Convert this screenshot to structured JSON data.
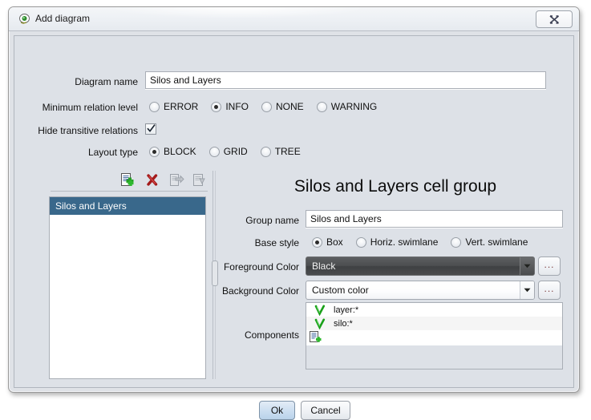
{
  "window": {
    "title": "Add diagram",
    "app_icon": "app-icon",
    "close_label": "x"
  },
  "form": {
    "diagram_name": {
      "label": "Diagram name",
      "value": "Silos and Layers",
      "placeholder": ""
    },
    "minimum_relation_level": {
      "label": "Minimum relation level",
      "options": [
        "ERROR",
        "INFO",
        "NONE",
        "WARNING"
      ],
      "selected": "INFO"
    },
    "hide_transitive_relations": {
      "label": "Hide transitive relations",
      "checked": true
    },
    "layout_type": {
      "label": "Layout type",
      "options": [
        "BLOCK",
        "GRID",
        "TREE"
      ],
      "selected": "BLOCK"
    }
  },
  "toolbar": {
    "add": "add-document-icon",
    "delete": "delete-icon",
    "move_right": "move-right-icon",
    "edit": "edit-document-icon"
  },
  "group_list": {
    "items": [
      {
        "label": "Silos and Layers",
        "selected": true
      }
    ]
  },
  "panel": {
    "title": "Silos and Layers cell group",
    "group_name": {
      "label": "Group name",
      "value": "Silos and Layers",
      "placeholder": ""
    },
    "base_style": {
      "label": "Base style",
      "options": [
        "Box",
        "Horiz. swimlane",
        "Vert. swimlane"
      ],
      "selected": "Box"
    },
    "foreground_color": {
      "label": "Foreground Color",
      "value": "Black",
      "browse_label": "..."
    },
    "background_color": {
      "label": "Background Color",
      "value": "Custom color",
      "browse_label": "..."
    },
    "components": {
      "label": "Components",
      "items": [
        {
          "icon": "green-check-icon",
          "text": "layer:*"
        },
        {
          "icon": "green-check-icon",
          "text": "silo:*"
        }
      ],
      "add_icon": "add-document-icon"
    }
  },
  "buttons": {
    "ok": "Ok",
    "cancel": "Cancel"
  },
  "colors": {
    "dialog_background": "#dde1e7",
    "selection_blue": "#39688b",
    "field_white": "#ffffff",
    "combo_dark": "#4c4e50",
    "check_green": "#2aa82a",
    "delete_red": "#a41b1b"
  }
}
